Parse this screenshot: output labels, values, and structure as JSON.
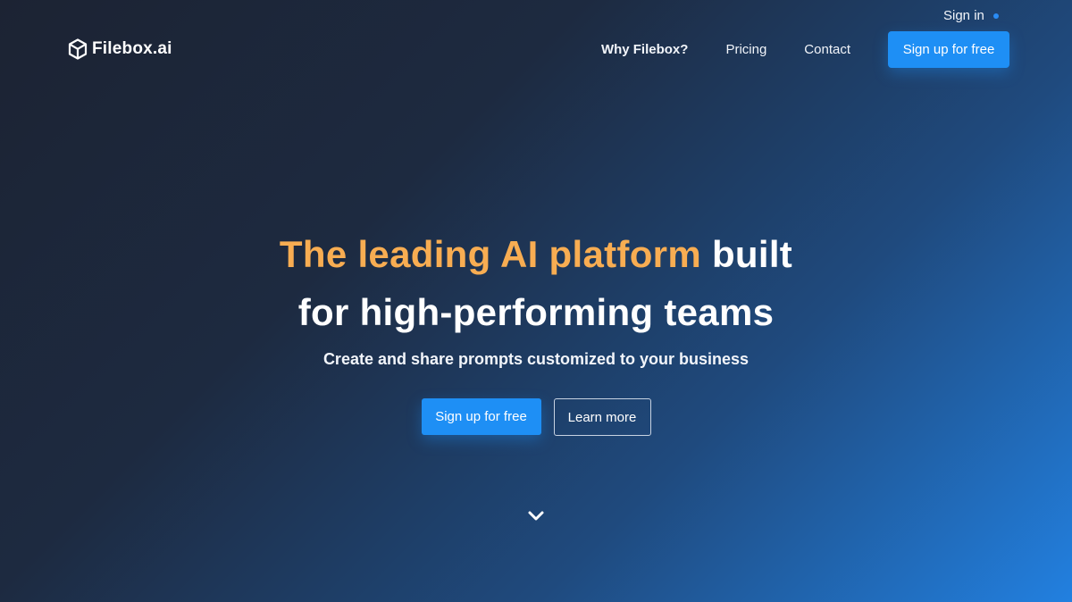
{
  "header": {
    "sign_in_label": "Sign in",
    "logo_text": "Filebox.ai",
    "nav": {
      "why_label": "Why Filebox?",
      "pricing_label": "Pricing",
      "contact_label": "Contact",
      "cta_label": "Sign up for free"
    }
  },
  "hero": {
    "headline_accent": "The leading AI platform",
    "headline_rest_1": " built",
    "headline_line_2": "for high-performing teams",
    "subheadline": "Create and share prompts customized to your business",
    "primary_button_label": "Sign up for free",
    "secondary_button_label": "Learn more"
  },
  "icons": {
    "logo": "cube-icon",
    "scroll": "chevron-down-icon",
    "status": "dot-icon"
  },
  "colors": {
    "accent_orange": "#f8ad52",
    "button_blue": "#1e8ff5",
    "background_dark": "#1c2333",
    "background_light": "#2280e0"
  }
}
